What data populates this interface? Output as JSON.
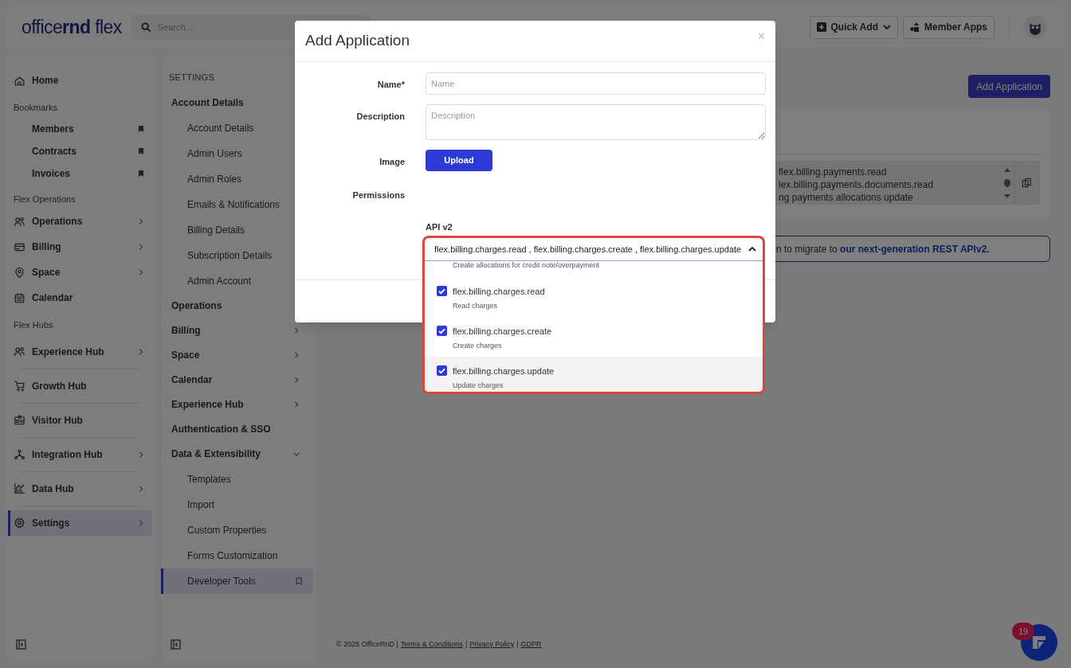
{
  "header": {
    "logo": "office**rnd** flex",
    "search": {
      "placeholder": "Search..."
    },
    "buttons": [
      {
        "label": "Quick Add",
        "kind": "dropdown"
      },
      {
        "label": "Member Apps",
        "kind": "apps"
      }
    ]
  },
  "sidebar": {
    "sections": [
      {
        "kind": "nav",
        "items": [
          {
            "label": "Home",
            "chevron": false,
            "selected": false
          }
        ]
      },
      {
        "kind": "bookmarks",
        "title": "Bookmarks",
        "items": [
          {
            "label": "Members",
            "selected": false
          },
          {
            "label": "Contracts",
            "selected": false
          },
          {
            "label": "Invoices",
            "selected": false
          }
        ]
      },
      {
        "kind": "nav",
        "title": "Flex Operations",
        "items": [
          {
            "label": "Operations",
            "chevron": true,
            "selected": false
          },
          {
            "label": "Billing",
            "chevron": true,
            "selected": false
          },
          {
            "label": "Space",
            "chevron": true,
            "selected": false
          },
          {
            "label": "Calendar",
            "chevron": false,
            "selected": false
          }
        ]
      },
      {
        "kind": "hubs",
        "title": "Flex Hubs",
        "items": [
          {
            "label": "Experience Hub",
            "chevron": true,
            "selected": false
          },
          {
            "label": "Growth Hub",
            "chevron": false,
            "selected": false
          },
          {
            "label": "Visitor Hub",
            "chevron": false,
            "selected": false
          },
          {
            "label": "Integration Hub",
            "chevron": true,
            "selected": false
          },
          {
            "label": "Data Hub",
            "chevron": true,
            "selected": false
          },
          {
            "label": "Settings",
            "chevron": true,
            "selected": true
          }
        ]
      }
    ]
  },
  "settings_menu": {
    "title": "SETTINGS",
    "groups": [
      {
        "label": "Account Details",
        "children": [
          {
            "label": "Account Details",
            "selected": false
          },
          {
            "label": "Admin Users",
            "selected": false
          },
          {
            "label": "Admin Roles",
            "selected": false
          },
          {
            "label": "Emails & Notifications",
            "selected": false
          },
          {
            "label": "Billing Details",
            "selected": false
          },
          {
            "label": "Subscription Details",
            "selected": false
          },
          {
            "label": "Admin Account",
            "selected": false
          }
        ]
      },
      {
        "label": "Operations"
      },
      {
        "label": "Billing",
        "chevron": true,
        "expanded": false
      },
      {
        "label": "Space",
        "chevron": true,
        "expanded": false
      },
      {
        "label": "Calendar",
        "chevron": true,
        "expanded": false
      },
      {
        "label": "Experience Hub",
        "chevron": true,
        "expanded": false
      },
      {
        "label": "Authentication & SSO"
      },
      {
        "label": "Data & Extensibility",
        "chevron": true,
        "expanded": true,
        "children": [
          {
            "label": "Templates",
            "selected": false
          },
          {
            "label": "Import",
            "selected": false
          },
          {
            "label": "Custom Properties",
            "selected": false
          },
          {
            "label": "Forms Customization",
            "selected": false
          },
          {
            "label": "Developer Tools",
            "selected": true
          }
        ]
      }
    ]
  },
  "main": {
    "add_button": "Add Application",
    "scopes": [
      "flex.billing.payments.read",
      "lex.billing.payments.documents.read",
      "ng payments allocations update"
    ],
    "banner": {
      "text": "n to migrate to ",
      "link": "our next-generation REST APIv2."
    }
  },
  "footer": {
    "items": [
      {
        "kind": "text",
        "text": "© 2025 OfficeRnD |"
      },
      {
        "kind": "link",
        "text": "Terms & Conditions"
      },
      {
        "kind": "text",
        "text": "|"
      },
      {
        "kind": "link",
        "text": "Privacy Policy"
      },
      {
        "kind": "text",
        "text": "|"
      },
      {
        "kind": "link",
        "text": "GDPR"
      }
    ]
  },
  "chat": {
    "badge": "19"
  },
  "modal": {
    "title": "Add Application",
    "close": "×",
    "fields": [
      {
        "label": "Name*",
        "kind": "input",
        "placeholder": "Name"
      },
      {
        "label": "Description",
        "kind": "textarea",
        "placeholder": "Description"
      },
      {
        "label": "Image",
        "kind": "upload",
        "button": "Upload"
      },
      {
        "label": "Permissions",
        "kind": "heading"
      }
    ],
    "api_label": "API v2",
    "dropdown": {
      "value": "flex.billing.charges.read , flex.billing.charges.create , flex.billing.charges.update",
      "expanded": true,
      "partial_above": "Create allocations for credit note/overpayment",
      "options": [
        {
          "name": "flex.billing.charges.read",
          "description": "Read charges",
          "checked": true,
          "highlighted": false
        },
        {
          "name": "flex.billing.charges.create",
          "description": "Create charges",
          "checked": true,
          "highlighted": false
        },
        {
          "name": "flex.billing.charges.update",
          "description": "Update charges",
          "checked": true,
          "highlighted": true
        }
      ]
    }
  }
}
